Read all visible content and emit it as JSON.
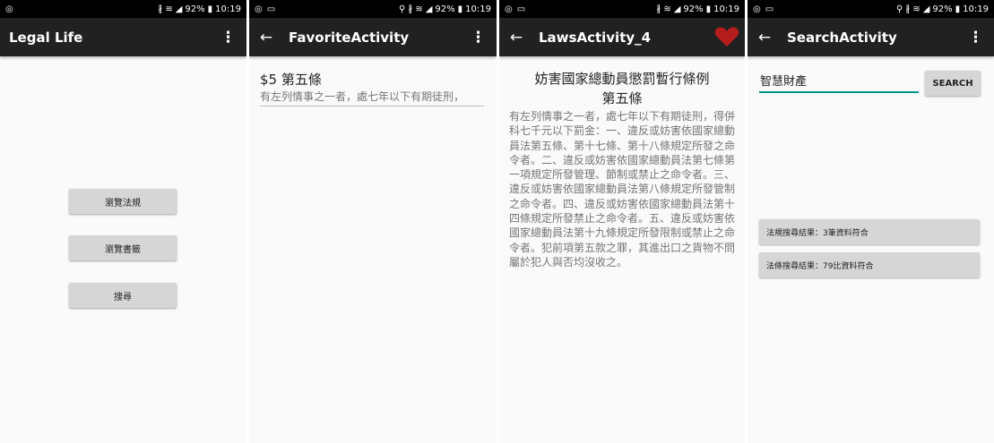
{
  "status": {
    "percent": "92%",
    "time": "10:19"
  },
  "screen1": {
    "title": "Legal Life",
    "buttons": [
      "瀏覽法規",
      "瀏覽書籤",
      "搜尋"
    ]
  },
  "screen2": {
    "title": "FavoriteActivity",
    "item_title": "$5 第五條",
    "item_preview": "有左列情事之一者，處七年以下有期徒刑，"
  },
  "screen3": {
    "title": "LawsActivity_4",
    "law_name": "妨害國家總動員懲罰暫行條例",
    "article": "第五條",
    "body": "有左列情事之一者，處七年以下有期徒刑，得併科七千元以下罰金：一、違反或妨害依國家總動員法第五條、第十七條、第十八條規定所發之命令者。二、違反或妨害依國家總動員法第七條第一項規定所發管理、節制或禁止之命令者。三、違反或妨害依國家總動員法第八條規定所發管制之命令者。四、違反或妨害依國家總動員法第十四條規定所發禁止之命令者。五、違反或妨害依國家總動員法第十九條規定所發限制或禁止之命令者。犯前項第五款之罪，其進出口之貨物不問屬於犯人與否均沒收之。",
    "heart_color": "#b71c1c"
  },
  "screen4": {
    "title": "SearchActivity",
    "search_value": "智慧財產",
    "search_button": "SEARCH",
    "results": [
      "法規搜尋結果：3筆資料符合",
      "法條搜尋結果：79比資料符合"
    ]
  },
  "colors": {
    "appbar": "#212121",
    "button": "#d6d6d6",
    "accent": "#009688"
  }
}
